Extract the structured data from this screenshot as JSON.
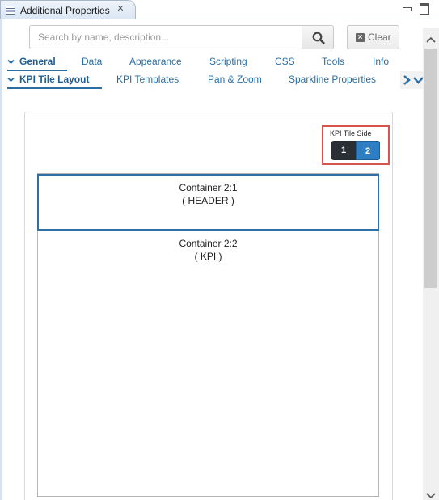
{
  "view": {
    "title": "Additional Properties",
    "close_glyph": "✕",
    "icon": "properties-view-icon"
  },
  "search": {
    "placeholder": "Search by name, description...",
    "value": "",
    "button_icon": "search-icon"
  },
  "clear": {
    "label": "Clear",
    "icon": "clear-x-icon"
  },
  "tabs_row1": [
    {
      "label": "General",
      "active": true
    },
    {
      "label": "Data",
      "active": false
    },
    {
      "label": "Appearance",
      "active": false
    },
    {
      "label": "Scripting",
      "active": false
    },
    {
      "label": "CSS",
      "active": false
    },
    {
      "label": "Tools",
      "active": false
    },
    {
      "label": "Info",
      "active": false
    }
  ],
  "tabs_row2": [
    {
      "label": "KPI Tile Layout",
      "active": true
    },
    {
      "label": "KPI Templates",
      "active": false
    },
    {
      "label": "Pan & Zoom",
      "active": false
    },
    {
      "label": "Sparkline Properties",
      "active": false
    }
  ],
  "kpi_tile_side": {
    "label": "KPI Tile Side",
    "options": [
      "1",
      "2"
    ],
    "selected": "2"
  },
  "containers": [
    {
      "title": "Container 2:1",
      "subtitle": "( HEADER )",
      "selected": true
    },
    {
      "title": "Container 2:2",
      "subtitle": "( KPI )",
      "selected": false
    }
  ],
  "colors": {
    "accent": "#2b6ea3",
    "highlight_border": "#d9534f",
    "toggle_selected": "#2e7ec4",
    "toggle_dark": "#2a2f36"
  }
}
